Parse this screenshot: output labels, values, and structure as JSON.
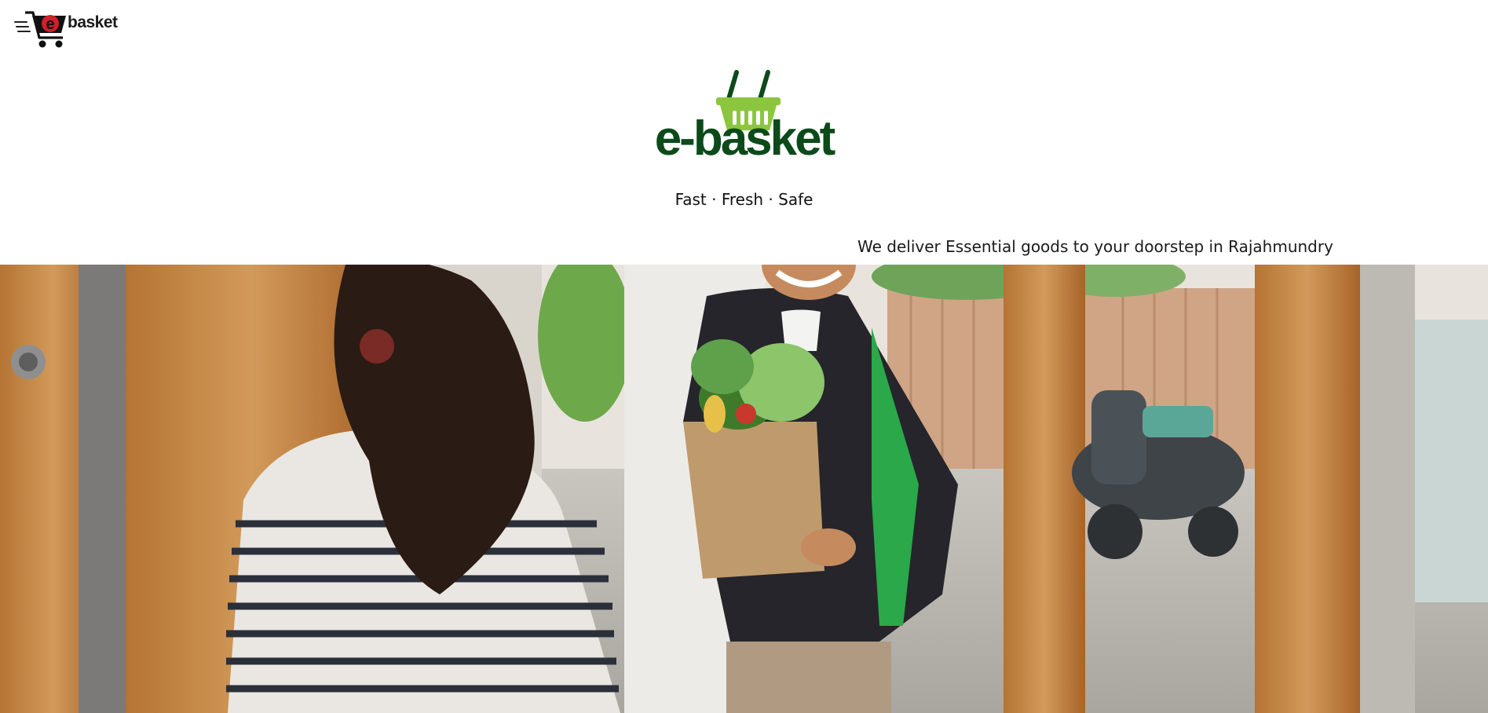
{
  "header": {
    "menu_icon": "hamburger-menu-icon",
    "cart_icon": "shopping-cart-icon",
    "brand_small": "basket"
  },
  "brand": {
    "logo_icon": "basket-icon",
    "logo_text": "e-basket",
    "tagline": "Fast · Fresh · Safe",
    "delivery_line": "We deliver Essential goods to your doorstep in Rajahmundry"
  },
  "hero": {
    "image_subject": "delivery-person-handing-grocery-bag-photo"
  },
  "colors": {
    "logo_green_dark": "#0c4a1a",
    "logo_green_light": "#8cc63f",
    "cart_red": "#d0202a"
  }
}
